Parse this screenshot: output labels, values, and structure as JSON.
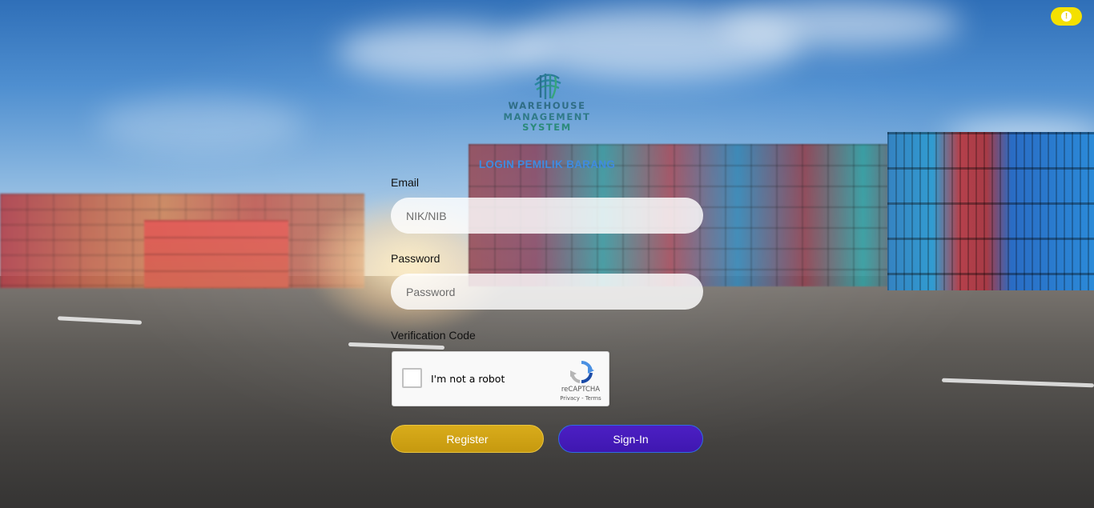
{
  "page": {
    "logo": {
      "line1": "WAREHOUSE",
      "line2": "MANAGEMENT",
      "line3": "SYSTEM"
    },
    "alert_icon": "exclamation-circle-icon"
  },
  "form": {
    "title": "LOGIN PEMILIK BARANG",
    "email_label": "Email",
    "email_placeholder": "NIK/NIB",
    "password_label": "Password",
    "password_placeholder": "Password",
    "verification_label": "Verification Code"
  },
  "captcha": {
    "label": "I'm not a robot",
    "brand": "reCAPTCHA",
    "privacy": "Privacy",
    "separator": " - ",
    "terms": "Terms"
  },
  "buttons": {
    "register": "Register",
    "signin": "Sign-In"
  },
  "colors": {
    "title": "#3f8be0",
    "register": "#d3a716",
    "signin": "#4519bd",
    "alert": "#f4e000"
  }
}
